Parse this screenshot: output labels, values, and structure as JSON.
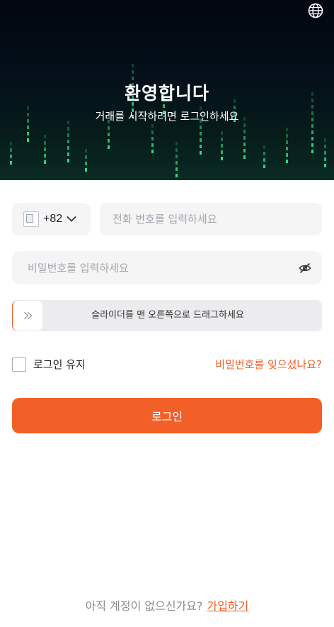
{
  "hero": {
    "title": "환영합니다",
    "subtitle": "거래를 시작하려면 로그인하세요",
    "language_icon": "globe-icon"
  },
  "form": {
    "country_code": "+82",
    "country_flag_icon": "broken-flag-image-icon",
    "phone_placeholder": "전화 번호를 입력하세요",
    "password_placeholder": "비밀번호를 입력하세요",
    "password_toggle_icon": "eye-slash-icon",
    "slider_text": "슬라이더를 맨 오른쪽으로 드래그하세요",
    "slider_handle_icon": "double-chevron-right-icon",
    "remember_label": "로그인 유지",
    "forgot_label": "비밀번호를 잊으셨나요?",
    "login_label": "로그인"
  },
  "footer": {
    "no_account": "아직 계정이 없으신가요?",
    "signup_label": "가입하기"
  },
  "colors": {
    "accent": "#f26027",
    "field_bg": "#f5f5f6",
    "hero_bg": "#02060f"
  }
}
